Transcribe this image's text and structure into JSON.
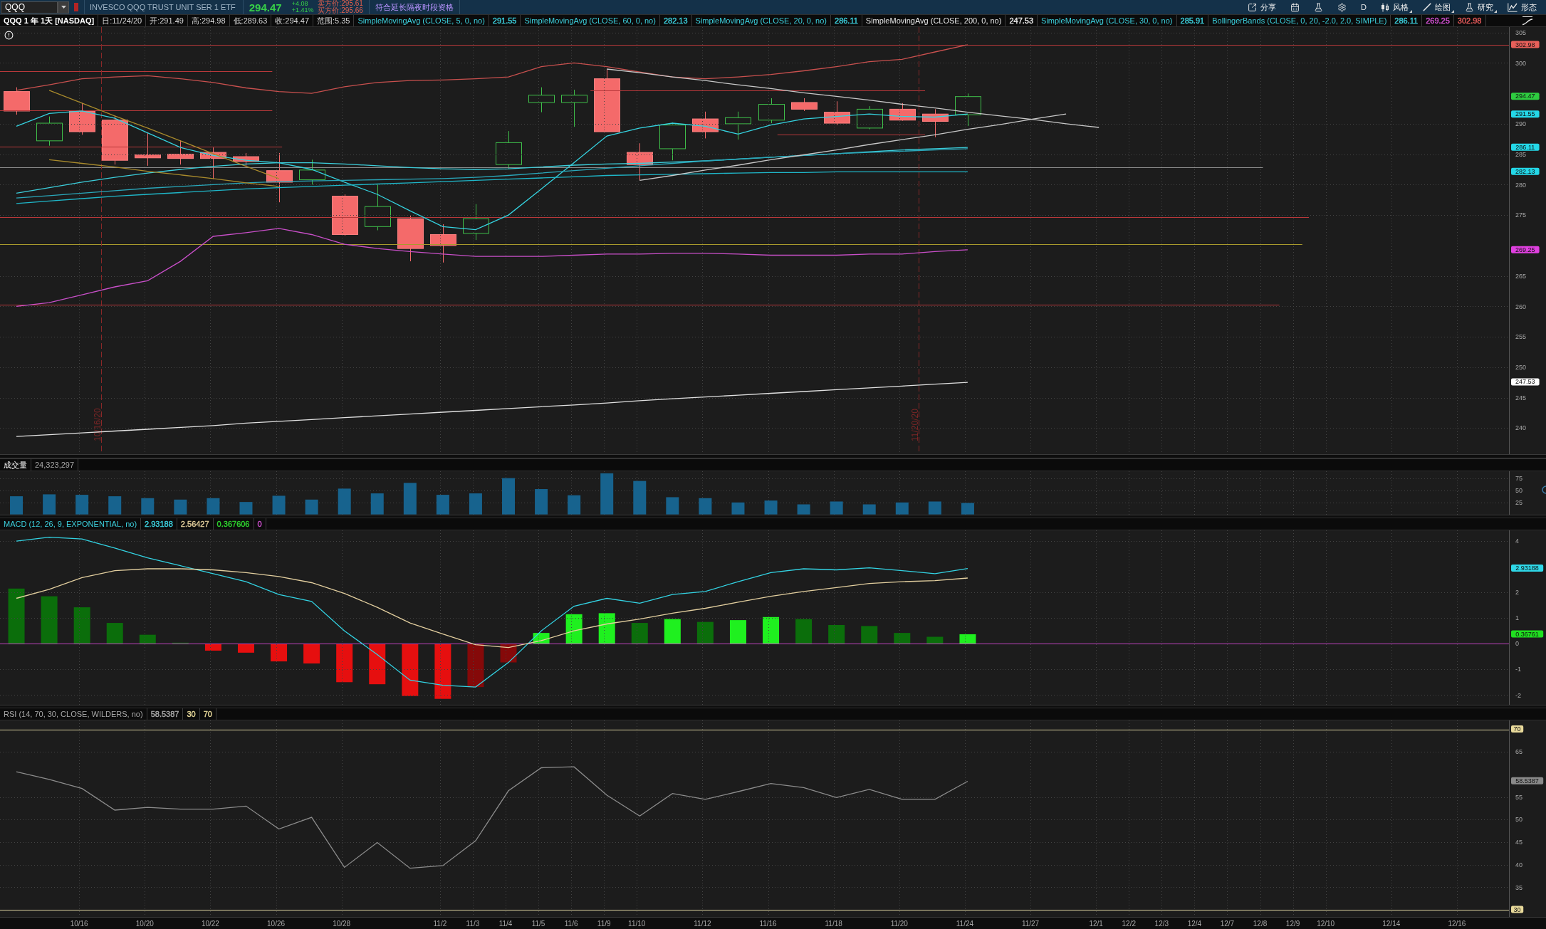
{
  "toolbar": {
    "symbol": "QQQ",
    "description": "INVESCO QQQ TRUST UNIT SER 1 ETF",
    "last_price": "294.47",
    "change": "+4.08",
    "change_percent": "+1.41%",
    "ask_quote": "卖方价:295.61",
    "bid_quote": "买方价:295.66",
    "extended_hours": "符合延长隔夜时段资格",
    "buttons": [
      {
        "kind": "share",
        "label": "分享",
        "menu": false
      },
      {
        "kind": "calendar",
        "menu": false
      },
      {
        "kind": "flask",
        "menu": false
      },
      {
        "kind": "gear",
        "menu": false
      },
      {
        "kind": "period",
        "label": "D",
        "menu": false
      },
      {
        "kind": "style",
        "label": "风格",
        "menu": true
      },
      {
        "kind": "drawing",
        "label": "绘图",
        "menu": true
      },
      {
        "kind": "studies",
        "label": "研究",
        "menu": true
      },
      {
        "kind": "patterns",
        "label": "形态",
        "menu": false
      }
    ]
  },
  "chart_header": {
    "title": "QQQ 1 年 1天 [NASDAQ]",
    "fields": [
      "日:11/24/20",
      "开:291.49",
      "高:294.98",
      "低:289.63",
      "收:294.47",
      "范围:5.35"
    ],
    "studies": [
      {
        "label": "SimpleMovingAvg (CLOSE, 5, 0, no)",
        "color": "#3ccfdc",
        "values": [
          {
            "text": "291.55",
            "color": "#3ccfdc"
          }
        ]
      },
      {
        "label": "SimpleMovingAvg (CLOSE, 60, 0, no)",
        "color": "#3ccfdc",
        "values": [
          {
            "text": "282.13",
            "color": "#3ccfdc"
          }
        ]
      },
      {
        "label": "SimpleMovingAvg (CLOSE, 20, 0, no)",
        "color": "#3ccfdc",
        "values": [
          {
            "text": "286.11",
            "color": "#3ccfdc"
          }
        ]
      },
      {
        "label": "SimpleMovingAvg (CLOSE, 200, 0, no)",
        "color": "#e6e6e6",
        "values": [
          {
            "text": "247.53",
            "color": "#e6e6e6"
          }
        ]
      },
      {
        "label": "SimpleMovingAvg (CLOSE, 30, 0, no)",
        "color": "#3ccfdc",
        "values": [
          {
            "text": "285.91",
            "color": "#3ccfdc"
          }
        ]
      },
      {
        "label": "BollingerBands (CLOSE, 0, 20, -2.0, 2.0, SIMPLE)",
        "color": "#3ccfdc",
        "values": [
          {
            "text": "286.11",
            "color": "#3ccfdc"
          },
          {
            "text": "269.25",
            "color": "#d652d6"
          },
          {
            "text": "302.98",
            "color": "#e85c5c"
          }
        ]
      }
    ]
  },
  "price_pane": {
    "chart_data": {
      "type": "line",
      "grid": true,
      "ylim": [
        235.7,
        305.9
      ],
      "yticks": [
        305,
        300,
        290,
        285,
        280,
        275,
        265,
        260,
        255,
        250,
        245,
        240
      ],
      "series": [
        {
          "color": "#35d3e0",
          "values": [
            289.6,
            291.7,
            292.1,
            290.9,
            288.5,
            286.1,
            284.8,
            284.0,
            283.6,
            282.5,
            280.4,
            278.4,
            275.7,
            273.1,
            272.6,
            275.0,
            279.3,
            283.6,
            288.0,
            289.3,
            290.1,
            289.6,
            288.3,
            289.8,
            290.8,
            291.2,
            291.6,
            291.2,
            291.1,
            291.6,
            null,
            null,
            null,
            null,
            null,
            null,
            null,
            null,
            null,
            null,
            null,
            null,
            null,
            null,
            null,
            null
          ]
        },
        {
          "color": "#1fb7c9",
          "values": [
            276.9,
            277.3,
            277.7,
            278.1,
            278.4,
            278.7,
            279.0,
            279.3,
            279.5,
            279.7,
            279.9,
            280.1,
            280.3,
            280.5,
            280.7,
            280.9,
            281.1,
            281.3,
            281.5,
            281.6,
            281.7,
            281.8,
            281.9,
            282.0,
            282.0,
            282.1,
            282.1,
            282.1,
            282.1,
            282.1,
            null,
            null,
            null,
            null,
            null,
            null,
            null,
            null,
            null,
            null,
            null,
            null,
            null,
            null,
            null,
            null
          ]
        },
        {
          "color": "#3ccfdc",
          "values": [
            278.6,
            279.5,
            280.4,
            281.2,
            281.9,
            282.5,
            283.0,
            283.4,
            283.6,
            283.6,
            283.4,
            283.1,
            282.8,
            282.6,
            282.5,
            282.6,
            282.9,
            283.2,
            283.4,
            283.5,
            283.7,
            283.9,
            284.2,
            284.5,
            284.8,
            285.1,
            285.4,
            285.7,
            285.9,
            286.1,
            null,
            null,
            null,
            null,
            null,
            null,
            null,
            null,
            null,
            null,
            null,
            null,
            null,
            null,
            null,
            null
          ]
        },
        {
          "color": "#e0e0e0",
          "values": [
            238.6,
            238.9,
            239.2,
            239.5,
            239.8,
            240.1,
            240.4,
            240.8,
            241.1,
            241.4,
            241.7,
            242.0,
            242.3,
            242.6,
            242.9,
            243.2,
            243.5,
            243.8,
            244.1,
            244.5,
            244.8,
            245.1,
            245.4,
            245.7,
            246.0,
            246.3,
            246.6,
            246.9,
            247.2,
            247.5,
            null,
            null,
            null,
            null,
            null,
            null,
            null,
            null,
            null,
            null,
            null,
            null,
            null,
            null,
            null,
            null
          ]
        },
        {
          "color": "#2aa8bb",
          "values": [
            277.8,
            278.2,
            278.6,
            279.0,
            279.4,
            279.7,
            280.0,
            280.3,
            280.5,
            280.6,
            280.7,
            280.8,
            280.9,
            281.0,
            281.2,
            281.5,
            281.9,
            282.3,
            282.7,
            283.1,
            283.5,
            283.9,
            284.2,
            284.5,
            284.8,
            285.1,
            285.3,
            285.5,
            285.7,
            285.9,
            null,
            null,
            null,
            null,
            null,
            null,
            null,
            null,
            null,
            null,
            null,
            null,
            null,
            null,
            null,
            null
          ]
        },
        {
          "color": "#c8504e",
          "values": [
            295.5,
            296.4,
            297.4,
            297.7,
            297.9,
            297.4,
            296.8,
            295.9,
            295.3,
            295.0,
            296.1,
            296.8,
            297.1,
            297.2,
            297.4,
            297.7,
            299.4,
            300.0,
            299.4,
            298.5,
            297.7,
            297.4,
            297.7,
            298.1,
            298.7,
            299.4,
            300.2,
            300.6,
            301.8,
            303.0,
            null,
            null,
            null,
            null,
            null,
            null,
            null,
            null,
            null,
            null,
            null,
            null,
            null,
            null,
            null,
            null
          ]
        },
        {
          "color": "#c84fc8",
          "values": [
            260.0,
            260.6,
            261.9,
            263.2,
            264.2,
            267.4,
            271.5,
            272.1,
            272.8,
            271.8,
            270.2,
            269.5,
            269.0,
            268.6,
            268.2,
            268.2,
            268.2,
            268.4,
            268.6,
            268.6,
            268.7,
            268.7,
            268.6,
            268.4,
            268.4,
            268.4,
            268.6,
            268.6,
            269.0,
            269.3,
            null,
            null,
            null,
            null,
            null,
            null,
            null,
            null,
            null,
            null,
            null,
            null,
            null,
            null,
            null,
            null
          ]
        },
        {
          "color": "#a88a2c",
          "values": [
            null,
            295.5,
            293.4,
            291.3,
            289.3,
            287.2,
            285.1,
            283.0,
            281.0,
            null,
            null,
            null,
            null,
            null,
            null,
            null,
            null,
            null,
            null,
            null,
            null,
            null,
            null,
            null,
            null,
            null,
            null,
            null,
            null,
            null,
            null,
            null,
            null,
            null,
            null,
            null,
            null,
            null,
            null,
            null,
            null,
            null,
            null,
            null,
            null,
            null
          ]
        },
        {
          "color": "#a88a2c",
          "values": [
            null,
            284.1,
            283.5,
            282.9,
            282.2,
            281.6,
            281.0,
            280.3,
            279.7,
            null,
            null,
            null,
            null,
            null,
            null,
            null,
            null,
            null,
            null,
            null,
            null,
            null,
            null,
            null,
            null,
            null,
            null,
            null,
            null,
            null,
            null,
            null,
            null,
            null,
            null,
            null,
            null,
            null,
            null,
            null,
            null,
            null,
            null,
            null,
            null,
            null
          ]
        },
        {
          "color": "#c8c8c8",
          "values": [
            null,
            null,
            null,
            null,
            null,
            null,
            null,
            null,
            null,
            null,
            null,
            null,
            null,
            null,
            null,
            null,
            null,
            null,
            299.0,
            298.4,
            297.7,
            297.1,
            296.4,
            295.8,
            295.1,
            294.5,
            293.9,
            293.2,
            292.6,
            291.9,
            291.3,
            290.7,
            290.0,
            289.4,
            null,
            null,
            null,
            null,
            null,
            null,
            null,
            null,
            null,
            null,
            null,
            null
          ]
        },
        {
          "color": "#c8c8c8",
          "values": [
            null,
            null,
            null,
            null,
            null,
            null,
            null,
            null,
            null,
            null,
            null,
            null,
            null,
            null,
            null,
            null,
            null,
            null,
            null,
            280.7,
            281.5,
            282.4,
            283.2,
            284.1,
            284.9,
            285.7,
            286.6,
            287.4,
            288.2,
            289.1,
            289.9,
            290.8,
            291.6,
            null,
            null,
            null,
            null,
            null,
            null,
            null,
            null,
            null,
            null,
            null,
            null,
            null
          ]
        }
      ],
      "ref_lines": [
        {
          "axis": "y",
          "value": 303.0,
          "color": "#b8383a"
        },
        {
          "axis": "y",
          "value": 298.7,
          "color": "#b8383a"
        },
        {
          "axis": "y",
          "value": 292.2,
          "color": "#b8383a"
        },
        {
          "axis": "y",
          "value": 295.5,
          "color": "#b8383a"
        },
        {
          "axis": "y",
          "value": 288.2,
          "color": "#b8383a"
        },
        {
          "axis": "y",
          "value": 286.2,
          "color": "#b8383a"
        },
        {
          "axis": "y",
          "value": 282.8,
          "color": "#8e8e8e"
        },
        {
          "axis": "y",
          "value": 274.7,
          "color": "#b8383a"
        },
        {
          "axis": "y",
          "value": 270.2,
          "color": "#a89a2c"
        },
        {
          "axis": "y",
          "value": 260.3,
          "color": "#b8383a"
        }
      ]
    },
    "date_markers": [
      "10/16/20",
      "11/20/20"
    ],
    "axis_badges": [
      {
        "text": "302.98",
        "color": "#e8605a"
      },
      {
        "text": "294.47",
        "color": "#2ecc40"
      },
      {
        "text": "291.55",
        "color": "#24d8e8"
      },
      {
        "text": "286.11",
        "color": "#24d8e8"
      },
      {
        "text": "282.13",
        "color": "#24d8e8"
      },
      {
        "text": "269.25",
        "color": "#e040e0"
      },
      {
        "text": "247.53",
        "color": "#ffffff"
      }
    ]
  },
  "volume_pane": {
    "header": {
      "title": "成交量",
      "value": "24,323,297"
    },
    "chart_data": {
      "type": "bar",
      "grid": true,
      "ylim": [
        -0.6,
        90.3
      ],
      "yticks": [
        75,
        50,
        25
      ],
      "series": [
        {
          "color": "#17638e",
          "values": [
            38,
            42,
            41,
            38,
            34,
            31,
            34,
            26,
            39,
            31,
            54,
            44,
            66,
            41,
            44,
            76,
            53,
            40,
            86,
            70,
            36,
            34,
            25,
            29,
            21,
            27,
            21,
            25,
            27,
            24,
            null,
            null,
            null,
            null,
            null,
            null,
            null,
            null,
            null,
            null,
            null,
            null,
            null,
            null,
            null,
            null
          ]
        }
      ]
    }
  },
  "macd_pane": {
    "header": {
      "title": "MACD (12, 26, 9, EXPONENTIAL, no)",
      "values": [
        {
          "text": "2.93188",
          "color": "#3ccfdc"
        },
        {
          "text": "2.56427",
          "color": "#e0cc9a"
        },
        {
          "text": "0.367606",
          "color": "#2ed12e"
        },
        {
          "text": "0",
          "color": "#d050d0"
        }
      ]
    },
    "chart_data": {
      "type": "line",
      "grid": true,
      "ylim": [
        -2.38,
        4.42
      ],
      "yticks": [
        4,
        2,
        1,
        0,
        -1,
        -2
      ],
      "series": [
        {
          "color": "#33d3e3",
          "values": [
            4.0,
            4.15,
            4.08,
            3.73,
            3.35,
            3.04,
            2.73,
            2.42,
            1.92,
            1.65,
            0.5,
            -0.42,
            -1.42,
            -1.62,
            -1.69,
            -0.73,
            0.5,
            1.46,
            1.77,
            1.58,
            1.92,
            2.04,
            2.42,
            2.77,
            2.92,
            2.88,
            2.96,
            2.85,
            2.73,
            2.93,
            null,
            null,
            null,
            null,
            null,
            null,
            null,
            null,
            null,
            null,
            null,
            null,
            null,
            null,
            null,
            null
          ]
        },
        {
          "color": "#e3cf9f",
          "values": [
            1.77,
            2.12,
            2.58,
            2.85,
            2.92,
            2.92,
            2.88,
            2.77,
            2.62,
            2.38,
            1.96,
            1.42,
            0.81,
            0.38,
            -0.04,
            -0.15,
            0.12,
            0.5,
            0.77,
            0.96,
            1.19,
            1.38,
            1.62,
            1.85,
            2.04,
            2.19,
            2.35,
            2.42,
            2.46,
            2.56,
            null,
            null,
            null,
            null,
            null,
            null,
            null,
            null,
            null,
            null,
            null,
            null,
            null,
            null,
            null,
            null
          ]
        }
      ],
      "ref_lines": [
        {
          "axis": "y",
          "value": 0,
          "color": "#c043c0"
        }
      ]
    },
    "axis_badges": [
      {
        "text": "2.93188",
        "color": "#2fd8e8"
      },
      {
        "text": "0.36761",
        "color": "#20e020"
      }
    ]
  },
  "rsi_pane": {
    "header": {
      "title": "RSI (14, 70, 30, CLOSE, WILDERS, no)",
      "values": [
        {
          "text": "58.5387",
          "color": "#a8a8a8"
        },
        {
          "text": "30",
          "color": "#e8d99a"
        },
        {
          "text": "70",
          "color": "#e8d99a"
        }
      ]
    },
    "chart_data": {
      "type": "line",
      "grid": true,
      "ylim": [
        28.42,
        71.99
      ],
      "yticks": [
        65,
        55,
        50,
        45,
        40,
        35
      ],
      "series": [
        {
          "color": "#8c8c8c",
          "values": [
            60.6,
            58.9,
            56.9,
            52.1,
            52.7,
            52.3,
            52.3,
            53.0,
            47.9,
            50.5,
            39.4,
            44.9,
            39.2,
            39.8,
            45.3,
            56.4,
            61.5,
            61.7,
            55.4,
            50.8,
            55.8,
            54.5,
            56.2,
            58.0,
            57.1,
            54.9,
            56.7,
            54.5,
            54.5,
            58.5,
            null,
            null,
            null,
            null,
            null,
            null,
            null,
            null,
            null,
            null,
            null,
            null,
            null,
            null,
            null,
            null
          ]
        }
      ],
      "ref_lines": [
        {
          "axis": "y",
          "value": 70,
          "color": "#d8cf9c"
        },
        {
          "axis": "y",
          "value": 30,
          "color": "#d8cf9c"
        }
      ]
    },
    "axis_badges": [
      {
        "text": "70",
        "color": "#e8d99a"
      },
      {
        "text": "58.5387",
        "color": "#8a8a8a"
      },
      {
        "text": "30",
        "color": "#e8d99a"
      }
    ]
  },
  "date_axis": {
    "labels": [
      "10/16",
      "10/20",
      "10/22",
      "10/26",
      "10/28",
      "11/2",
      "11/3",
      "11/4",
      "11/5",
      "11/6",
      "11/9",
      "11/10",
      "11/12",
      "11/16",
      "11/18",
      "11/20",
      "11/24",
      "11/27",
      "12/1",
      "12/2",
      "12/3",
      "12/4",
      "12/7",
      "12/8",
      "12/9",
      "12/10",
      "12/14",
      "12/16"
    ]
  }
}
